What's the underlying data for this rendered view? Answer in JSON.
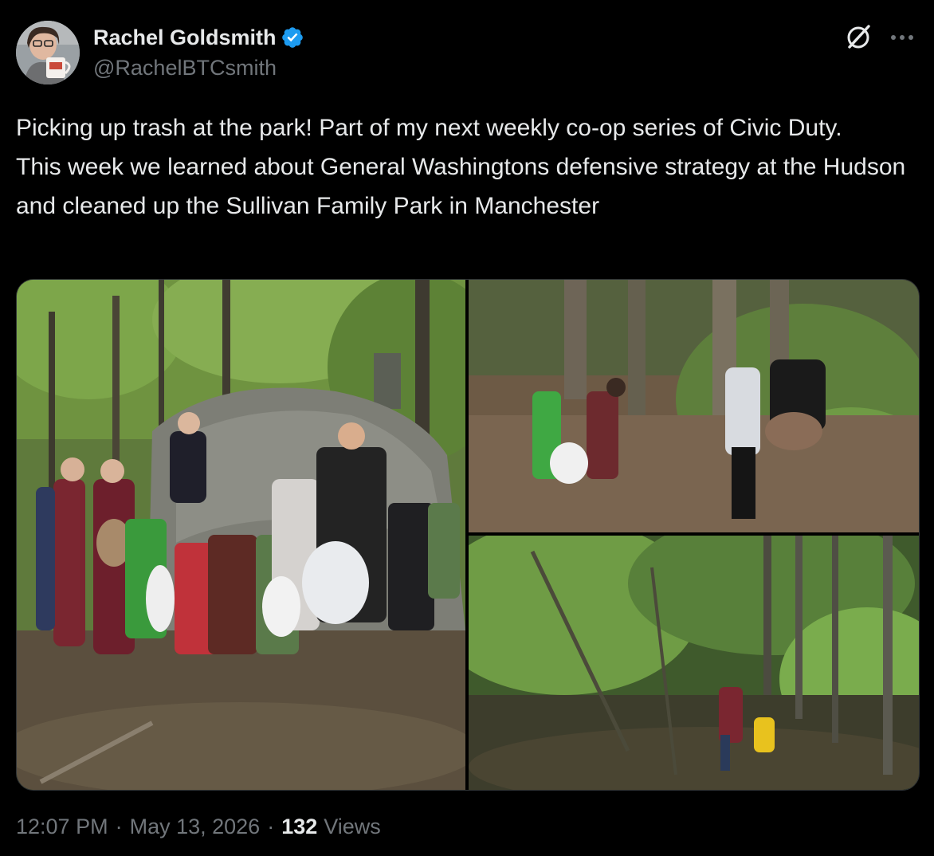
{
  "author": {
    "display_name": "Rachel Goldsmith",
    "handle": "@RachelBTCsmith",
    "verified": true,
    "avatar_icon": "avatar-photo"
  },
  "header_icons": {
    "grok": "grok-icon",
    "more": "more-icon"
  },
  "tweet": {
    "text_lines": [
      "Picking up trash at the park! Part of my next weekly co-op series of Civic Duty.",
      "This week we learned about General Washingtons defensive strategy at the Hudson and cleaned up the Sullivan Family Park in Manchester"
    ]
  },
  "media": {
    "photos": [
      {
        "icon": "group-photo"
      },
      {
        "icon": "kids-picking-trash-photo"
      },
      {
        "icon": "woods-photo"
      }
    ]
  },
  "meta": {
    "time": "12:07 PM",
    "separator": "·",
    "date": "May 13, 2026",
    "views_count": "132",
    "views_label": "Views"
  },
  "colors": {
    "background": "#000000",
    "primary_text": "#e7e9ea",
    "secondary_text": "#71767b",
    "verified_blue": "#1d9bf0",
    "border": "#2f3336"
  }
}
